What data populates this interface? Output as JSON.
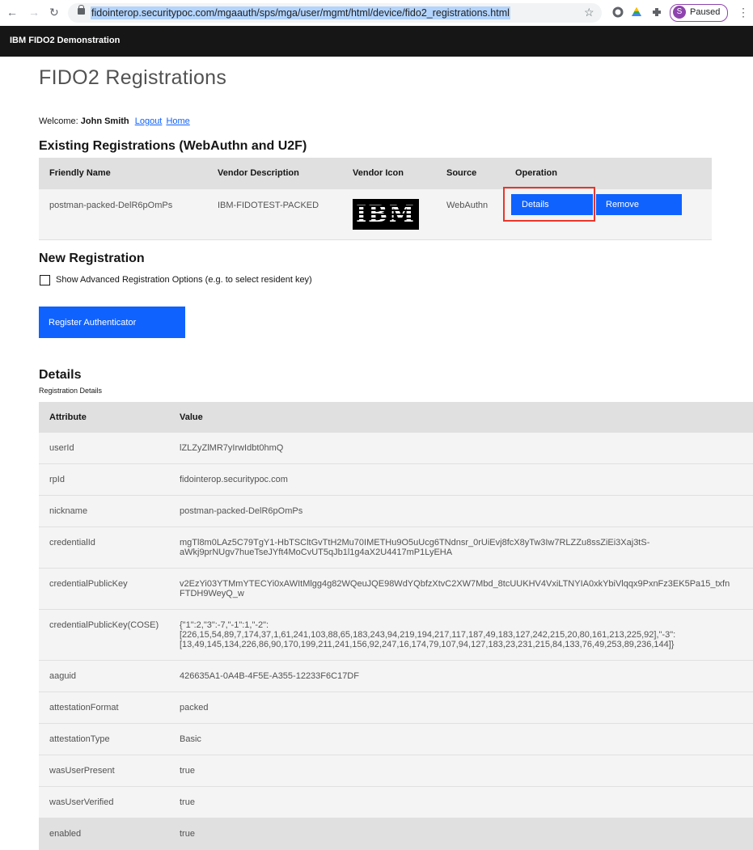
{
  "browser": {
    "url": "fidointerop.securitypoc.com/mgaauth/sps/mga/user/mgmt/html/device/fido2_registrations.html",
    "profile_initial": "S",
    "profile_status": "Paused"
  },
  "app": {
    "title": "IBM FIDO2 Demonstration"
  },
  "page": {
    "title": "FIDO2 Registrations",
    "welcome_prefix": "Welcome:",
    "user_name": "John Smith",
    "logout_link": "Logout",
    "home_link": "Home"
  },
  "existing": {
    "heading": "Existing Registrations (WebAuthn and U2F)",
    "columns": [
      "Friendly Name",
      "Vendor Description",
      "Vendor Icon",
      "Source",
      "Operation"
    ],
    "rows": [
      {
        "friendly_name": "postman-packed-DelR6pOmPs",
        "vendor_description": "IBM-FIDOTEST-PACKED",
        "vendor_icon_text": "IBM",
        "source": "WebAuthn",
        "details_label": "Details",
        "remove_label": "Remove"
      }
    ]
  },
  "new_registration": {
    "heading": "New Registration",
    "advanced_label": "Show Advanced Registration Options (e.g. to select resident key)",
    "register_button": "Register Authenticator"
  },
  "details": {
    "heading": "Details",
    "subheading": "Registration Details",
    "columns": [
      "Attribute",
      "Value"
    ],
    "rows": [
      {
        "attribute": "userId",
        "value": "lZLZyZlMR7yIrwIdbt0hmQ"
      },
      {
        "attribute": "rpId",
        "value": "fidointerop.securitypoc.com"
      },
      {
        "attribute": "nickname",
        "value": "postman-packed-DelR6pOmPs"
      },
      {
        "attribute": "credentialId",
        "value": "mgTl8m0LAz5C79TgY1-HbTSCltGvTtH2Mu70IMETHu9O5uUcg6TNdnsr_0rUiEvj8fcX8yTw3Iw7RLZZu8ssZiEi3Xaj3tS-\naWkj9prNUgv7hueTseJYft4MoCvUT5qJb1l1g4aX2U4417mP1LyEHA"
      },
      {
        "attribute": "credentialPublicKey",
        "value": "v2EzYi03YTMmYTECYi0xAWItMlgg4g82WQeuJQE98WdYQbfzXtvC2XW7Mbd_8tcUUKHV4VxiLTNYIA0xkYbiVlqqx9PxnFz3EK5Pa15_txfn\nFTDH9WeyQ_w"
      },
      {
        "attribute": "credentialPublicKey(COSE)",
        "value": "{\"1\":2,\"3\":-7,\"-1\":1,\"-2\":\n[226,15,54,89,7,174,37,1,61,241,103,88,65,183,243,94,219,194,217,117,187,49,183,127,242,215,20,80,161,213,225,92],\"-3\":\n[13,49,145,134,226,86,90,170,199,211,241,156,92,247,16,174,79,107,94,127,183,23,231,215,84,133,76,49,253,89,236,144]}"
      },
      {
        "attribute": "aaguid",
        "value": "426635A1-0A4B-4F5E-A355-12233F6C17DF"
      },
      {
        "attribute": "attestationFormat",
        "value": "packed"
      },
      {
        "attribute": "attestationType",
        "value": "Basic"
      },
      {
        "attribute": "wasUserPresent",
        "value": "true"
      },
      {
        "attribute": "wasUserVerified",
        "value": "true"
      },
      {
        "attribute": "enabled",
        "value": "true"
      }
    ]
  }
}
